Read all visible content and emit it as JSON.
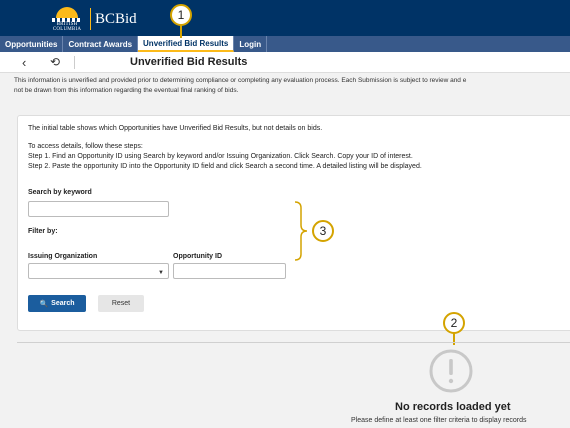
{
  "header": {
    "province_line1": "BRITISH",
    "province_line2": "COLUMBIA",
    "app_name": "BCBid"
  },
  "nav": {
    "items": [
      {
        "label": "Opportunities",
        "active": false
      },
      {
        "label": "Contract Awards",
        "active": false
      },
      {
        "label": "Unverified Bid Results",
        "active": true
      },
      {
        "label": "Login",
        "active": false
      }
    ]
  },
  "subbar": {
    "back_icon": "chevron-left-icon",
    "history_icon": "history-icon",
    "title": "Unverified Bid Results"
  },
  "disclaimer": {
    "line1": "This information is unverified and provided prior to determining compliance or completing any evaluation process. Each Submission is subject to review and e",
    "line2": "not be drawn from this information regarding the eventual final ranking of bids."
  },
  "card": {
    "intro": "The initial table shows which Opportunities have Unverified Bid Results, but not details on bids.",
    "steps_heading": "To access details, follow these steps:",
    "step1": "Step 1. Find an Opportunity ID using Search by keyword and/or Issuing Organization. Click Search. Copy your ID of interest.",
    "step2": "Step 2. Paste the opportunity ID into the Opportunity ID field and click Search a second time. A detailed listing will be displayed.",
    "keyword_label": "Search by keyword",
    "keyword_value": "",
    "filter_label": "Filter by:",
    "org_label": "Issuing Organization",
    "org_value": "",
    "oppid_label": "Opportunity ID",
    "oppid_value": "",
    "search_label": "Search",
    "reset_label": "Reset"
  },
  "callouts": [
    "1",
    "2",
    "3"
  ],
  "empty_state": {
    "icon": "alert-circle-icon",
    "title": "No records loaded yet",
    "subtitle": "Please define at least one filter criteria to display records"
  },
  "colors": {
    "header_bg": "#003366",
    "nav_bg": "#38598a",
    "accent": "#fcba19",
    "primary_button": "#1b5d9e",
    "callout_border": "#d4a300"
  }
}
